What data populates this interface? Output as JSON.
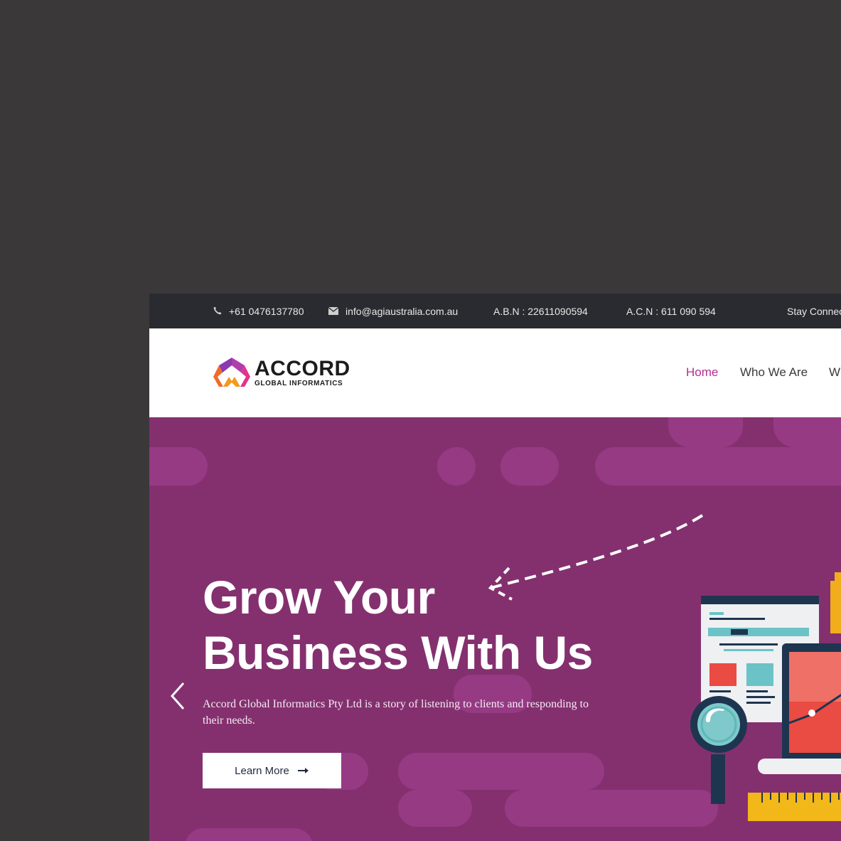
{
  "topbar": {
    "phone": "+61 0476137780",
    "email": "info@agiaustralia.com.au",
    "abn": "A.B.N : 22611090594",
    "acn": "A.C.N : 611 090 594",
    "stay_connected": "Stay Connec"
  },
  "logo": {
    "name": "ACCORD",
    "subtitle": "GLOBAL INFORMATICS"
  },
  "nav": {
    "items": [
      {
        "label": "Home",
        "active": true
      },
      {
        "label": "Who We Are",
        "active": false
      },
      {
        "label": "Wh",
        "active": false
      }
    ]
  },
  "hero": {
    "title_line1": "Grow Your",
    "title_line2": "Business With Us",
    "description": "Accord Global Informatics Pty Ltd is a story of listening to clients and responding to their needs.",
    "cta_label": "Learn More"
  },
  "icons": {
    "phone": "phone-icon",
    "email": "envelope-icon",
    "cta_arrow": "arrow-right-icon",
    "prev": "chevron-left-icon"
  },
  "colors": {
    "accent": "#b52c95",
    "hero_bg": "#84306f",
    "topbar_bg": "#2a2b30"
  }
}
